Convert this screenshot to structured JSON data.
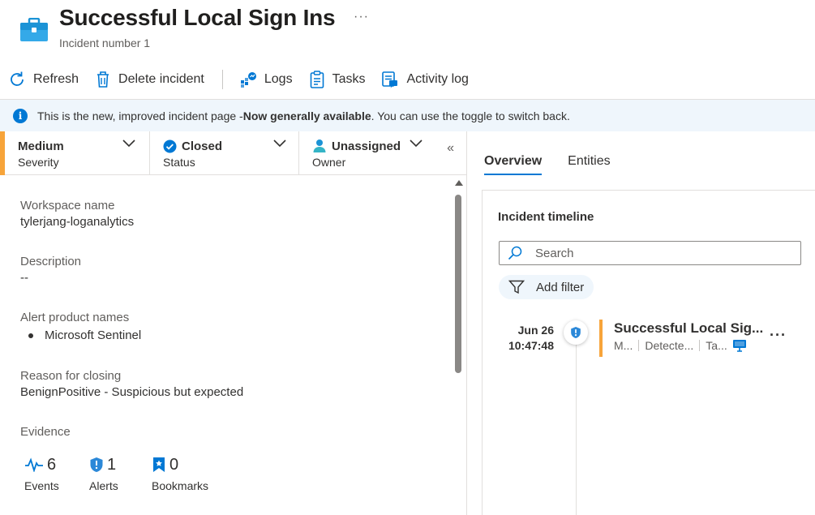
{
  "header": {
    "title": "Successful Local Sign Ins",
    "subtitle": "Incident number 1",
    "more": "···",
    "icon": "briefcase-icon"
  },
  "toolbar": {
    "refresh": "Refresh",
    "delete": "Delete incident",
    "logs": "Logs",
    "tasks": "Tasks",
    "activity": "Activity log"
  },
  "banner": {
    "icon": "i",
    "text_pre": "This is the new, improved incident page - ",
    "text_bold": "Now generally available",
    "text_post": ". You can use the toggle to switch back."
  },
  "status": {
    "severity_value": "Medium",
    "severity_label": "Severity",
    "status_value": "Closed",
    "status_label": "Status",
    "owner_value": "Unassigned",
    "owner_label": "Owner",
    "collapse": "«"
  },
  "details": {
    "workspace_label": "Workspace name",
    "workspace_value": "tylerjang-loganalytics",
    "description_label": "Description",
    "description_value": "--",
    "alert_products_label": "Alert product names",
    "alert_products": [
      "Microsoft Sentinel"
    ],
    "reason_label": "Reason for closing",
    "reason_value": "BenignPositive - Suspicious but expected",
    "evidence_label": "Evidence"
  },
  "evidence": {
    "events_count": "6",
    "events_label": "Events",
    "alerts_count": "1",
    "alerts_label": "Alerts",
    "bookmarks_count": "0",
    "bookmarks_label": "Bookmarks"
  },
  "right": {
    "tabs": [
      "Overview",
      "Entities"
    ],
    "timeline_title": "Incident timeline",
    "search_placeholder": "Search",
    "add_filter": "Add filter",
    "timeline_item": {
      "date": "Jun 26",
      "time": "10:47:48",
      "title": "Successful Local Sig...",
      "meta1": "M...",
      "meta2": "Detecte...",
      "meta3": "Ta...",
      "more": "···"
    }
  },
  "colors": {
    "accent": "#0078d4",
    "severity_medium": "#f7a43a",
    "banner_bg": "#eff6fc"
  }
}
